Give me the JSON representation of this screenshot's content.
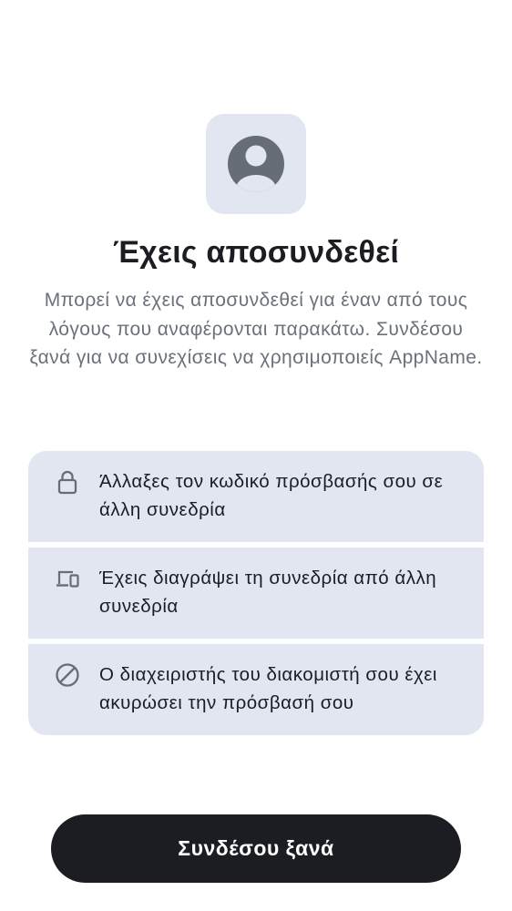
{
  "title": "Έχεις αποσυνδεθεί",
  "subtitle": "Μπορεί να έχεις αποσυνδεθεί για έναν από τους λόγους που αναφέρονται παρακάτω. Συνδέσου ξανά για να συνεχίσεις να χρησιμοποιείς AppName.",
  "reasons": [
    {
      "icon": "lock-icon",
      "text": "Άλλαξες τον κωδικό πρόσβασής σου σε άλλη συνεδρία"
    },
    {
      "icon": "devices-icon",
      "text": "Έχεις διαγράψει τη συνεδρία από άλλη συνεδρία"
    },
    {
      "icon": "block-icon",
      "text": "Ο διαχειριστής του διακομιστή σου έχει ακυρώσει την πρόσβασή σου"
    }
  ],
  "cta_label": "Συνδέσου ξανά",
  "colors": {
    "tile_background": "#e1e6f0",
    "icon": "#676d76",
    "button": "#1b1d22",
    "title": "#1b1d22",
    "subtitle": "#6b717c"
  }
}
